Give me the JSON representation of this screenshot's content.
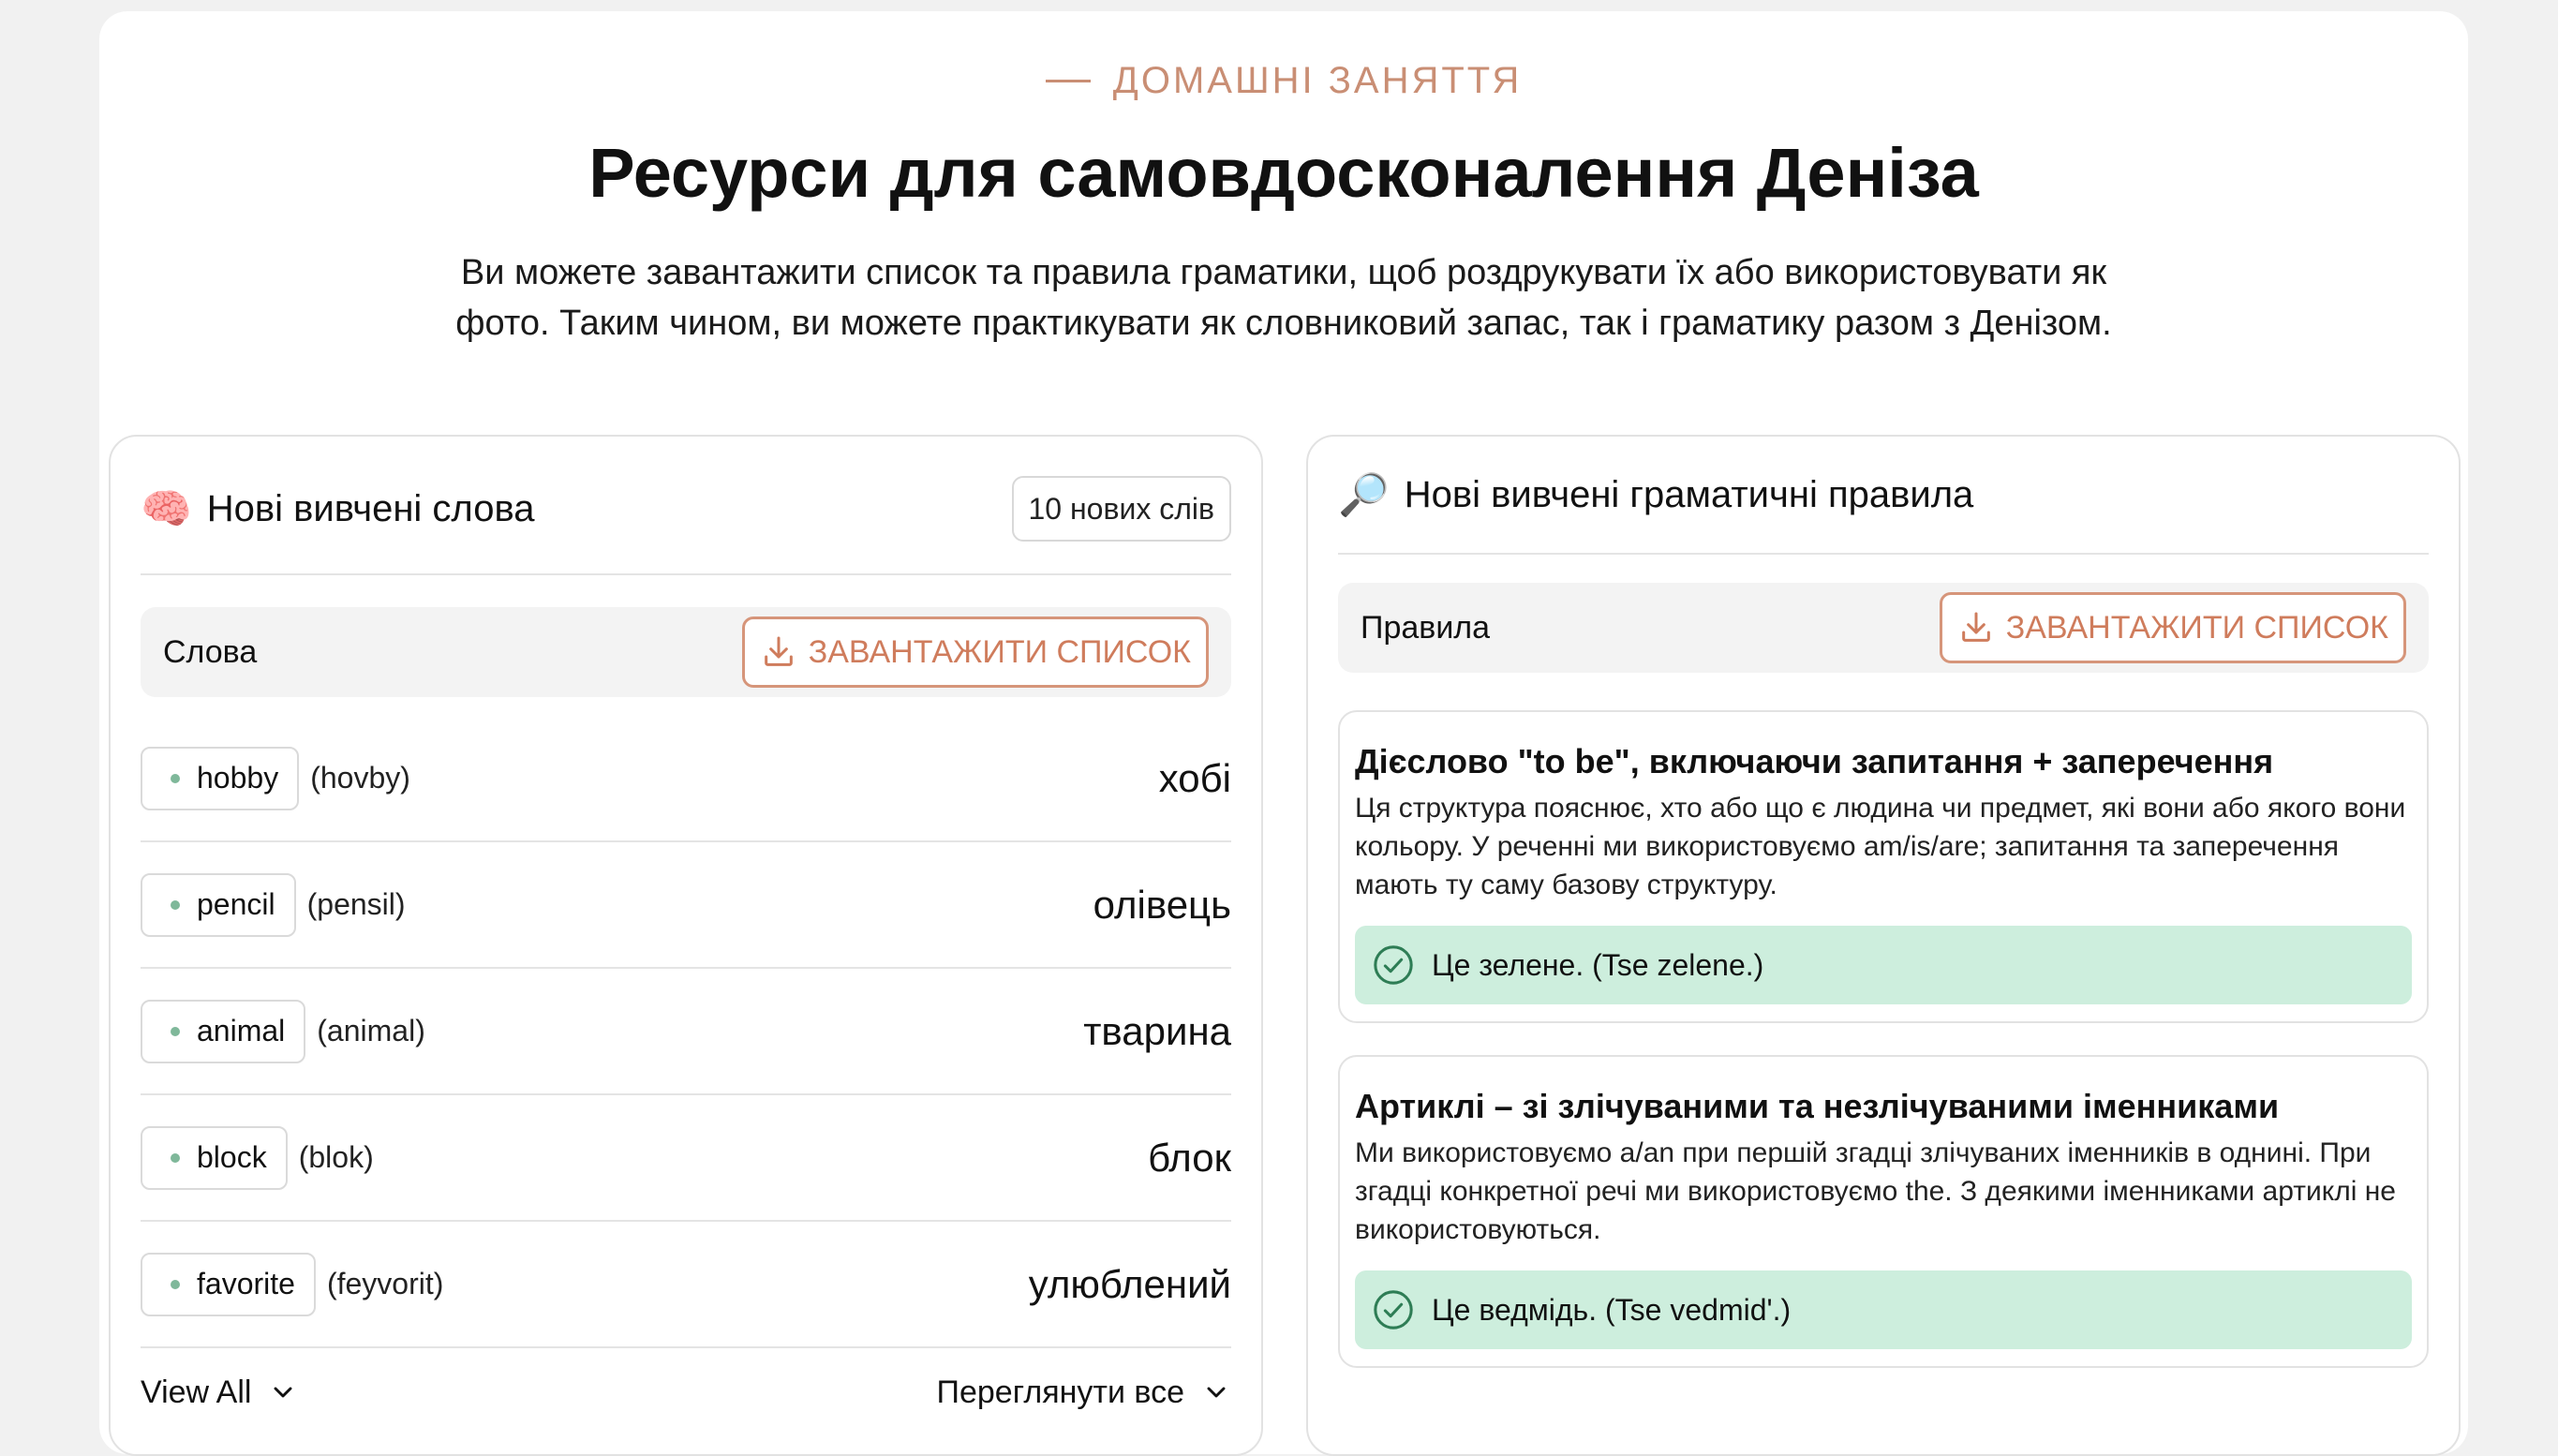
{
  "header": {
    "eyebrow": "ДОМАШНІ ЗАНЯТТЯ",
    "title": "Ресурси для самовдосконалення Деніза",
    "subtitle": "Ви можете завантажити список та правила граматики, щоб роздрукувати їх або використовувати як фото. Таким чином, ви можете практикувати як словниковий запас, так і граматику разом з Денізом."
  },
  "words_card": {
    "emoji": "🧠",
    "title": "Нові вивчені слова",
    "count_badge": "10 нових слів",
    "bar_label": "Слова",
    "download_label": "ЗАВАНТАЖИТИ СПИСОК",
    "items": [
      {
        "word": "hobby",
        "pron": "(hovby)",
        "translation": "хобі"
      },
      {
        "word": "pencil",
        "pron": "(pensil)",
        "translation": "олівець"
      },
      {
        "word": "animal",
        "pron": "(animal)",
        "translation": "тварина"
      },
      {
        "word": "block",
        "pron": "(blok)",
        "translation": "блок"
      },
      {
        "word": "favorite",
        "pron": "(feyvorit)",
        "translation": "улюблений"
      }
    ],
    "view_all": "View All",
    "view_all_uk": "Переглянути все"
  },
  "grammar_card": {
    "emoji": "🔎",
    "title": "Нові вивчені граматичні правила",
    "bar_label": "Правила",
    "download_label": "ЗАВАНТАЖИТИ СПИСОК",
    "rules": [
      {
        "title": "Дієслово \"to be\", включаючи запитання + заперечення",
        "text": "Ця структура пояснює, хто або що є людина чи предмет, які вони або якого вони кольору. У реченні ми використовуємо am/is/are; запитання та заперечення мають ту саму базову структуру.",
        "example": "Це зелене. (Tse zelene.)"
      },
      {
        "title": "Артиклі – зі злічуваними та незлічуваними іменниками",
        "text": "Ми використовуємо a/an при першій згадці злічуваних іменників в однині. При згадці конкретної речі ми використовуємо the. З деякими іменниками артиклі не використовуються.",
        "example": "Це ведмідь. (Tse vedmid'.)"
      }
    ]
  },
  "colors": {
    "accent": "#cf7c5c",
    "example_bg": "#cdeedd",
    "dot": "#7fb89a"
  }
}
